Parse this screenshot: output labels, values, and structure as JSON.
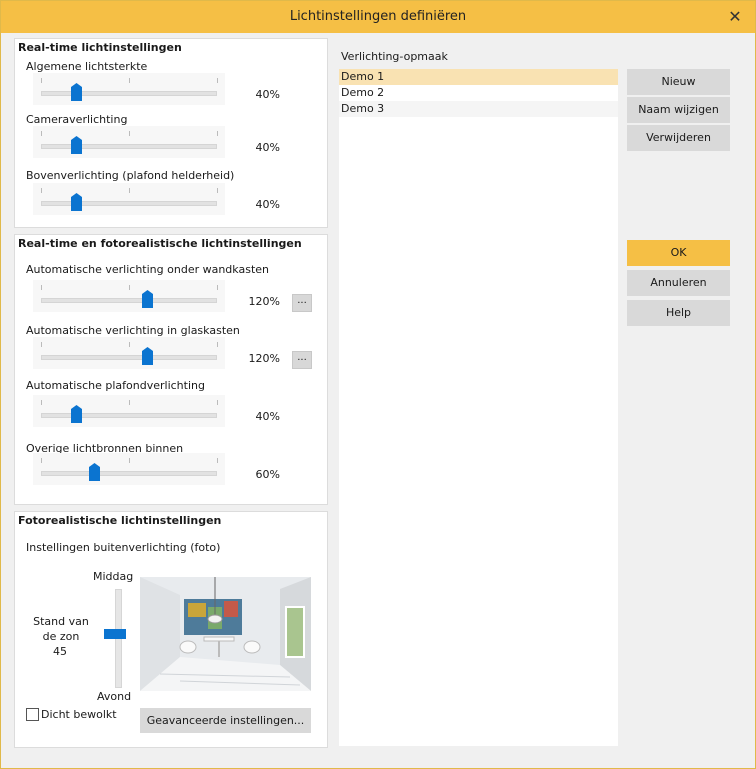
{
  "window": {
    "title": "Lichtinstellingen definiëren",
    "close_glyph": "✕"
  },
  "realtime": {
    "title": "Real-time lichtinstellingen",
    "sliders": [
      {
        "label": "Algemene lichtsterkte",
        "value_text": "40%",
        "level": 0.2
      },
      {
        "label": "Cameraverlichting",
        "value_text": "40%",
        "level": 0.2
      },
      {
        "label": "Bovenverlichting (plafond helderheid)",
        "value_text": "40%",
        "level": 0.2
      }
    ]
  },
  "photoreal_rt": {
    "title": "Real-time en fotorealistische lichtinstellingen",
    "sliders": [
      {
        "label": "Automatische verlichting onder wandkasten",
        "value_text": "120%",
        "level": 0.6,
        "has_more": true
      },
      {
        "label": "Automatische verlichting in glaskasten",
        "value_text": "120%",
        "level": 0.6,
        "has_more": true
      },
      {
        "label": "Automatische plafondverlichting",
        "value_text": "40%",
        "level": 0.2,
        "has_more": false
      },
      {
        "label": "Overige lichtbronnen binnen",
        "value_text": "60%",
        "level": 0.3,
        "has_more": false
      }
    ],
    "more_label": "..."
  },
  "photoreal": {
    "title": "Fotorealistische lichtinstellingen",
    "subtitle": "Instellingen buitenverlichting (foto)",
    "top_label": "Middag",
    "bottom_label": "Avond",
    "sun_label": "Stand van de zon",
    "sun_value": "45",
    "cloudy_label": "Dicht bewolkt",
    "cloudy_checked": false,
    "advanced_button": "Geavanceerde instellingen..."
  },
  "layouts": {
    "title": "Verlichting-opmaak",
    "items": [
      "Demo 1",
      "Demo 2",
      "Demo 3"
    ],
    "selected_index": 0
  },
  "buttons": {
    "new": "Nieuw",
    "rename": "Naam wijzigen",
    "delete": "Verwijderen",
    "ok": "OK",
    "cancel": "Annuleren",
    "help": "Help"
  },
  "colors": {
    "accent": "#f5bf45",
    "thumb": "#0b74d0",
    "selection": "#f9e2b2"
  }
}
